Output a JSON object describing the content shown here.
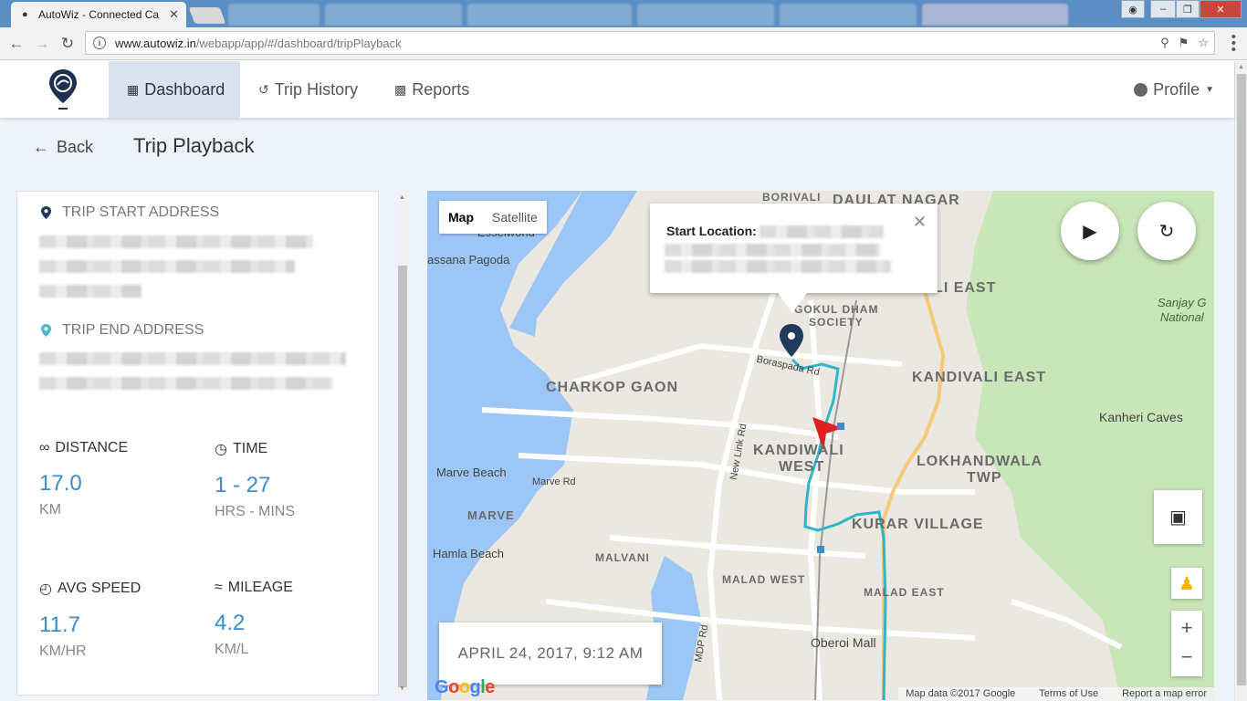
{
  "browser": {
    "tab_title": "AutoWiz - Connected Ca",
    "url_host": "www.autowiz.in",
    "url_path": "/webapp/app/#/dashboard/tripPlayback"
  },
  "header": {
    "nav": [
      {
        "label": "Dashboard"
      },
      {
        "label": "Trip History"
      },
      {
        "label": "Reports"
      }
    ],
    "profile_label": "Profile"
  },
  "subheader": {
    "back_label": "Back",
    "title": "Trip Playback"
  },
  "trip": {
    "start_address_heading": "TRIP START ADDRESS",
    "end_address_heading": "TRIP END ADDRESS",
    "stats": [
      {
        "label": "DISTANCE",
        "value": "17.0",
        "unit": "KM",
        "icon": "infinity-icon"
      },
      {
        "label": "TIME",
        "value": "1 - 27",
        "unit": "HRS - MINS",
        "icon": "clock-icon"
      },
      {
        "label": "AVG SPEED",
        "value": "11.7",
        "unit": "KM/HR",
        "icon": "speedometer-icon"
      },
      {
        "label": "MILEAGE",
        "value": "4.2",
        "unit": "KM/L",
        "icon": "fuel-gauge-icon"
      }
    ]
  },
  "map": {
    "type_map": "Map",
    "type_satellite": "Satellite",
    "info_title": "Start Location:",
    "date_label": "APRIL 24, 2017, 9:12 AM",
    "labels": {
      "borivali": "BORIVALI",
      "daulat_nagar": "DAULAT NAGAR",
      "esselworld": "Esselworld",
      "pagoda": "assana Pagoda",
      "borivali_east": "BORIVALI EAST",
      "gokul": "GOKUL DHAM",
      "society": "SOCIETY",
      "sanjay1": "Sanjay G",
      "sanjay2": "National",
      "boraspada": "Boraspada Rd",
      "charkop": "CHARKOP GAON",
      "kandivali_east": "KANDIVALI EAST",
      "kanheri": "Kanheri Caves",
      "kandivali_west1": "KANDIWALI",
      "kandivali_west2": "WEST",
      "lokhandwala1": "LOKHANDWALA",
      "lokhandwala2": "TWP",
      "marve_beach": "Marve Beach",
      "marve_rd": "Marve Rd",
      "marve": "MARVE",
      "kurar": "KURAR VILLAGE",
      "hamla": "Hamla Beach",
      "malvani": "MALVANI",
      "malad_west": "MALAD WEST",
      "malad_east": "MALAD EAST",
      "oberoi": "Oberoi Mall",
      "new_link_rd": "New Link Rd",
      "mdp_rd": "MDP Rd"
    },
    "attribution": {
      "data": "Map data ©2017 Google",
      "terms": "Terms of Use",
      "report": "Report a map error"
    },
    "google": "Google"
  },
  "colors": {
    "accent": "#3a8dc8",
    "route": "#2fb6c8",
    "active_nav": "#dbe3f0",
    "marker": "#1f3a5a",
    "car": "#e02020"
  }
}
